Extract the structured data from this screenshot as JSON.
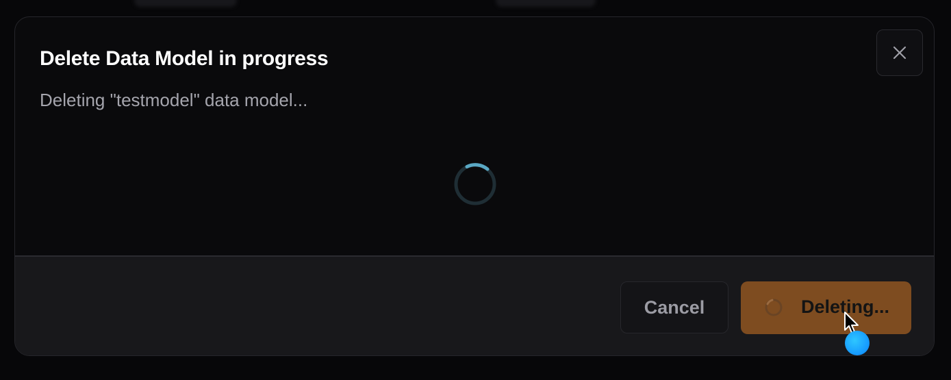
{
  "dialog": {
    "title": "Delete Data Model in progress",
    "description": "Deleting \"testmodel\" data model...",
    "close_icon": "close-icon",
    "spinner_icon": "loading-spinner-icon"
  },
  "footer": {
    "cancel_label": "Cancel",
    "delete_label": "Deleting..."
  },
  "colors": {
    "accent": "#7e4c20",
    "spinner": "#5aa8c4",
    "cursor_dot": "#0a84ff"
  }
}
